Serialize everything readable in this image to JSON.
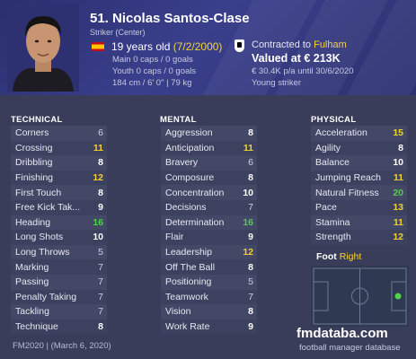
{
  "header": {
    "name": "51. Nicolas Santos-Clase",
    "position": "Striker (Center)",
    "age_prefix": "19 years old ",
    "dob": "(7/2/2000)",
    "main_caps": "Main 0 caps / 0 goals",
    "youth_caps": "Youth 0 caps / 0 goals",
    "physique": "184 cm / 6' 0\" | 79 kg",
    "contract_prefix": "Contracted to ",
    "club": "Fulham",
    "value": "Valued at € 213K",
    "wage": "€ 30.4K p/a until 30/6/2020",
    "role": "Young striker"
  },
  "technical": {
    "title": "TECHNICAL",
    "attributes": [
      {
        "name": "Corners",
        "value": "6"
      },
      {
        "name": "Crossing",
        "value": "11"
      },
      {
        "name": "Dribbling",
        "value": "8"
      },
      {
        "name": "Finishing",
        "value": "12"
      },
      {
        "name": "First Touch",
        "value": "8"
      },
      {
        "name": "Free Kick Tak...",
        "value": "9"
      },
      {
        "name": "Heading",
        "value": "16"
      },
      {
        "name": "Long Shots",
        "value": "10"
      },
      {
        "name": "Long Throws",
        "value": "5"
      },
      {
        "name": "Marking",
        "value": "7"
      },
      {
        "name": "Passing",
        "value": "7"
      },
      {
        "name": "Penalty Taking",
        "value": "7"
      },
      {
        "name": "Tackling",
        "value": "7"
      },
      {
        "name": "Technique",
        "value": "8"
      }
    ]
  },
  "mental": {
    "title": "MENTAL",
    "attributes": [
      {
        "name": "Aggression",
        "value": "8"
      },
      {
        "name": "Anticipation",
        "value": "11"
      },
      {
        "name": "Bravery",
        "value": "6"
      },
      {
        "name": "Composure",
        "value": "8"
      },
      {
        "name": "Concentration",
        "value": "10"
      },
      {
        "name": "Decisions",
        "value": "7"
      },
      {
        "name": "Determination",
        "value": "16"
      },
      {
        "name": "Flair",
        "value": "9"
      },
      {
        "name": "Leadership",
        "value": "12"
      },
      {
        "name": "Off The Ball",
        "value": "8"
      },
      {
        "name": "Positioning",
        "value": "5"
      },
      {
        "name": "Teamwork",
        "value": "7"
      },
      {
        "name": "Vision",
        "value": "8"
      },
      {
        "name": "Work Rate",
        "value": "9"
      }
    ]
  },
  "physical": {
    "title": "PHYSICAL",
    "attributes": [
      {
        "name": "Acceleration",
        "value": "15"
      },
      {
        "name": "Agility",
        "value": "8"
      },
      {
        "name": "Balance",
        "value": "10"
      },
      {
        "name": "Jumping Reach",
        "value": "11"
      },
      {
        "name": "Natural Fitness",
        "value": "20"
      },
      {
        "name": "Pace",
        "value": "13"
      },
      {
        "name": "Stamina",
        "value": "11"
      },
      {
        "name": "Strength",
        "value": "12"
      }
    ]
  },
  "foot": {
    "label": "Foot",
    "value": "Right"
  },
  "footer": {
    "left": "FM2020 | (March 6, 2020)",
    "brand": "fmdataba.com",
    "brand_sub": "football manager database"
  },
  "colors": {
    "background": "#3a3d59",
    "header": "#2d3170",
    "accent_yellow": "#f4d33c",
    "high_green": "#4fd14b",
    "pitch_player_dot": "#4fd14b"
  }
}
